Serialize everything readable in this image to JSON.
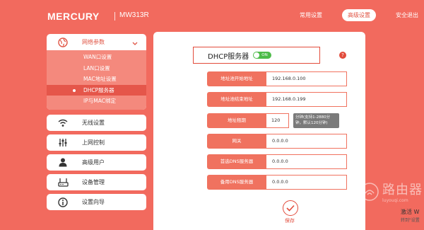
{
  "header": {
    "logo": "MERCURY",
    "model": "MW313R",
    "nav": [
      "常用设置",
      "高级设置",
      "安全退出"
    ]
  },
  "sidebar": {
    "groups": [
      {
        "label": "网络参数",
        "icon": "globe-icon"
      },
      {
        "label": "无线设置",
        "icon": "wifi-icon"
      },
      {
        "label": "上网控制",
        "icon": "sliders-icon"
      },
      {
        "label": "高级用户",
        "icon": "user-icon"
      },
      {
        "label": "设备管理",
        "icon": "router-icon"
      },
      {
        "label": "设置向导",
        "icon": "info-icon"
      }
    ],
    "network_sub": [
      "WAN口设置",
      "LAN口设置",
      "MAC地址设置",
      "DHCP服务器",
      "IP与MAC绑定"
    ]
  },
  "main": {
    "title": "DHCP服务器",
    "toggle_label": "ON",
    "help": "?",
    "fields": [
      {
        "label": "地址池开始地址",
        "value": "192.168.0.100"
      },
      {
        "label": "地址池结束地址",
        "value": "192.168.0.199"
      },
      {
        "label": "地址租期",
        "value": "120",
        "hint": "分钟(支持1-2880分钟，默认120分钟)"
      },
      {
        "label": "网关",
        "value": "0.0.0.0"
      },
      {
        "label": "首选DNS服务器",
        "value": "0.0.0.0"
      },
      {
        "label": "备用DNS服务器",
        "value": "0.0.0.0"
      }
    ],
    "save_label": "保存"
  },
  "watermark": {
    "text": "路由器",
    "sub": "luyouqi.com"
  },
  "os": {
    "activate": "激活 W",
    "activate_sub": "转到\"设置"
  },
  "colors": {
    "accent": "#f26a5e",
    "active_red": "#e24b3b",
    "toggle_green": "#4dbb49"
  }
}
